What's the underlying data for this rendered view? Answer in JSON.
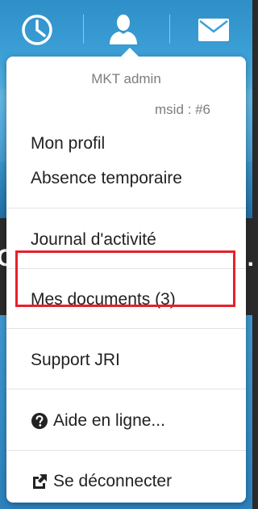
{
  "colors": {
    "highlight": "#e8202a",
    "menu_text": "#222222",
    "muted_text": "#7d7d7d",
    "header_blue": "#3c9fd6"
  },
  "nav": {
    "icons": [
      "clock-icon",
      "user-icon",
      "mail-icon"
    ]
  },
  "menu": {
    "user_name": "MKT admin",
    "msid": "msid : #6",
    "items": [
      {
        "label": "Mon profil"
      },
      {
        "label": "Absence temporaire"
      },
      {
        "label": "Journal d'activité"
      },
      {
        "label": "Mes documents (3)"
      },
      {
        "label": "Support JRI",
        "highlighted": true
      },
      {
        "label": "Aide en ligne...",
        "icon": "question-circle-icon"
      },
      {
        "label": "Se déconnecter",
        "icon": "external-link-icon"
      }
    ]
  },
  "background": {
    "fragment_left": "C",
    "fragment_right": "..."
  }
}
